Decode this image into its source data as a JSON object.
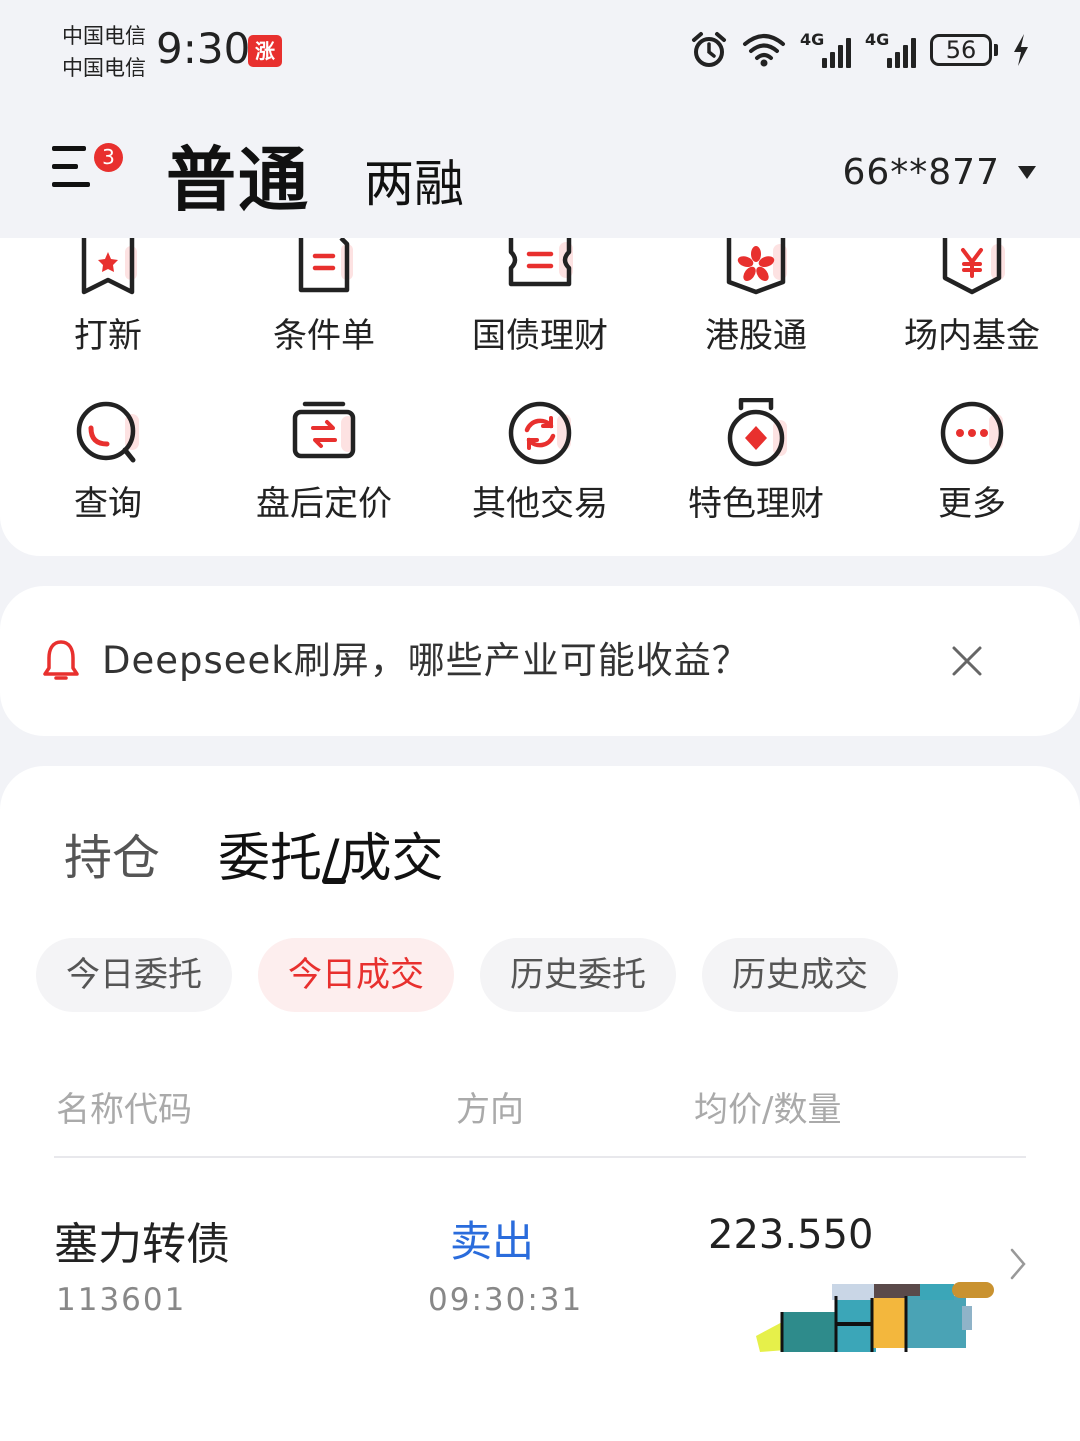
{
  "status_bar": {
    "carrier_1": "中国电信",
    "carrier_2": "中国电信",
    "time": "9:30",
    "app_badge": "涨",
    "network_1": "4G",
    "network_2": "4G",
    "battery": "56"
  },
  "header": {
    "menu_badge": "3",
    "tab_normal": "普通",
    "tab_margin": "两融",
    "account": "66**877"
  },
  "functions": [
    {
      "label": "打新",
      "icon": "ipo-ribbon-icon"
    },
    {
      "label": "条件单",
      "icon": "conditional-order-icon"
    },
    {
      "label": "国债理财",
      "icon": "bond-ticket-icon"
    },
    {
      "label": "港股通",
      "icon": "hk-connect-flower-icon"
    },
    {
      "label": "场内基金",
      "icon": "yuan-fund-icon"
    },
    {
      "label": "查询",
      "icon": "search-query-icon"
    },
    {
      "label": "盘后定价",
      "icon": "after-hours-exchange-icon"
    },
    {
      "label": "其他交易",
      "icon": "refresh-trade-icon"
    },
    {
      "label": "特色理财",
      "icon": "medal-diamond-icon"
    },
    {
      "label": "更多",
      "icon": "more-dots-icon"
    }
  ],
  "notice": {
    "text": "Deepseek刷屏，哪些产业可能收益？"
  },
  "trade": {
    "tab_positions": "持仓",
    "tab_orders": "委托/成交",
    "chips": [
      "今日委托",
      "今日成交",
      "历史委托",
      "历史成交"
    ],
    "active_chip": "今日成交",
    "columns": [
      "名称代码",
      "方向",
      "均价/数量"
    ],
    "rows": [
      {
        "name": "塞力转债",
        "code": "113601",
        "direction": "卖出",
        "time": "09:30:31",
        "price": "223.550"
      }
    ]
  },
  "colors": {
    "accent_red": "#e8302e",
    "sell_blue": "#2a6cdc",
    "background": "#f2f3f7"
  }
}
